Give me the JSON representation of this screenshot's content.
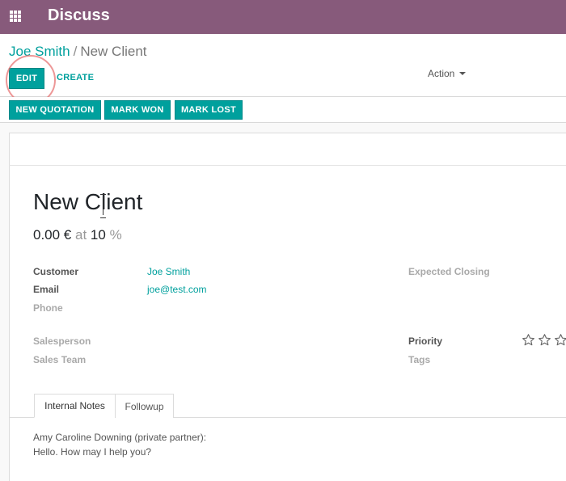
{
  "navbar": {
    "app_title": "Discuss",
    "icon": "apps-grid-icon",
    "color": "#875a7b"
  },
  "breadcrumb": {
    "parent": "Joe Smith",
    "separator": "/",
    "current": "New Client"
  },
  "control_panel": {
    "edit_label": "EDIT",
    "create_label": "CREATE",
    "action_label": "Action"
  },
  "statusbar": {
    "new_quotation_label": "NEW QUOTATION",
    "mark_won_label": "MARK WON",
    "mark_lost_label": "MARK LOST"
  },
  "record": {
    "title": "New Client",
    "revenue_amount": "0.00 €",
    "revenue_at": "at",
    "probability": "10",
    "probability_unit": "%"
  },
  "fields": {
    "customer_label": "Customer",
    "customer_value": "Joe Smith",
    "email_label": "Email",
    "email_value": "joe@test.com",
    "phone_label": "Phone",
    "salesperson_label": "Salesperson",
    "sales_team_label": "Sales Team",
    "expected_closing_label": "Expected Closing",
    "priority_label": "Priority",
    "priority_stars_filled": 0,
    "priority_stars_total": 3,
    "tags_label": "Tags"
  },
  "tabs": [
    {
      "label": "Internal Notes",
      "active": true
    },
    {
      "label": "Followup",
      "active": false
    }
  ],
  "notes": {
    "line1": "Amy Caroline Downing (private partner):",
    "line2": "Hello. How may I help you?"
  },
  "colors": {
    "accent": "#00a09d",
    "highlight_circle": "#e77474"
  }
}
